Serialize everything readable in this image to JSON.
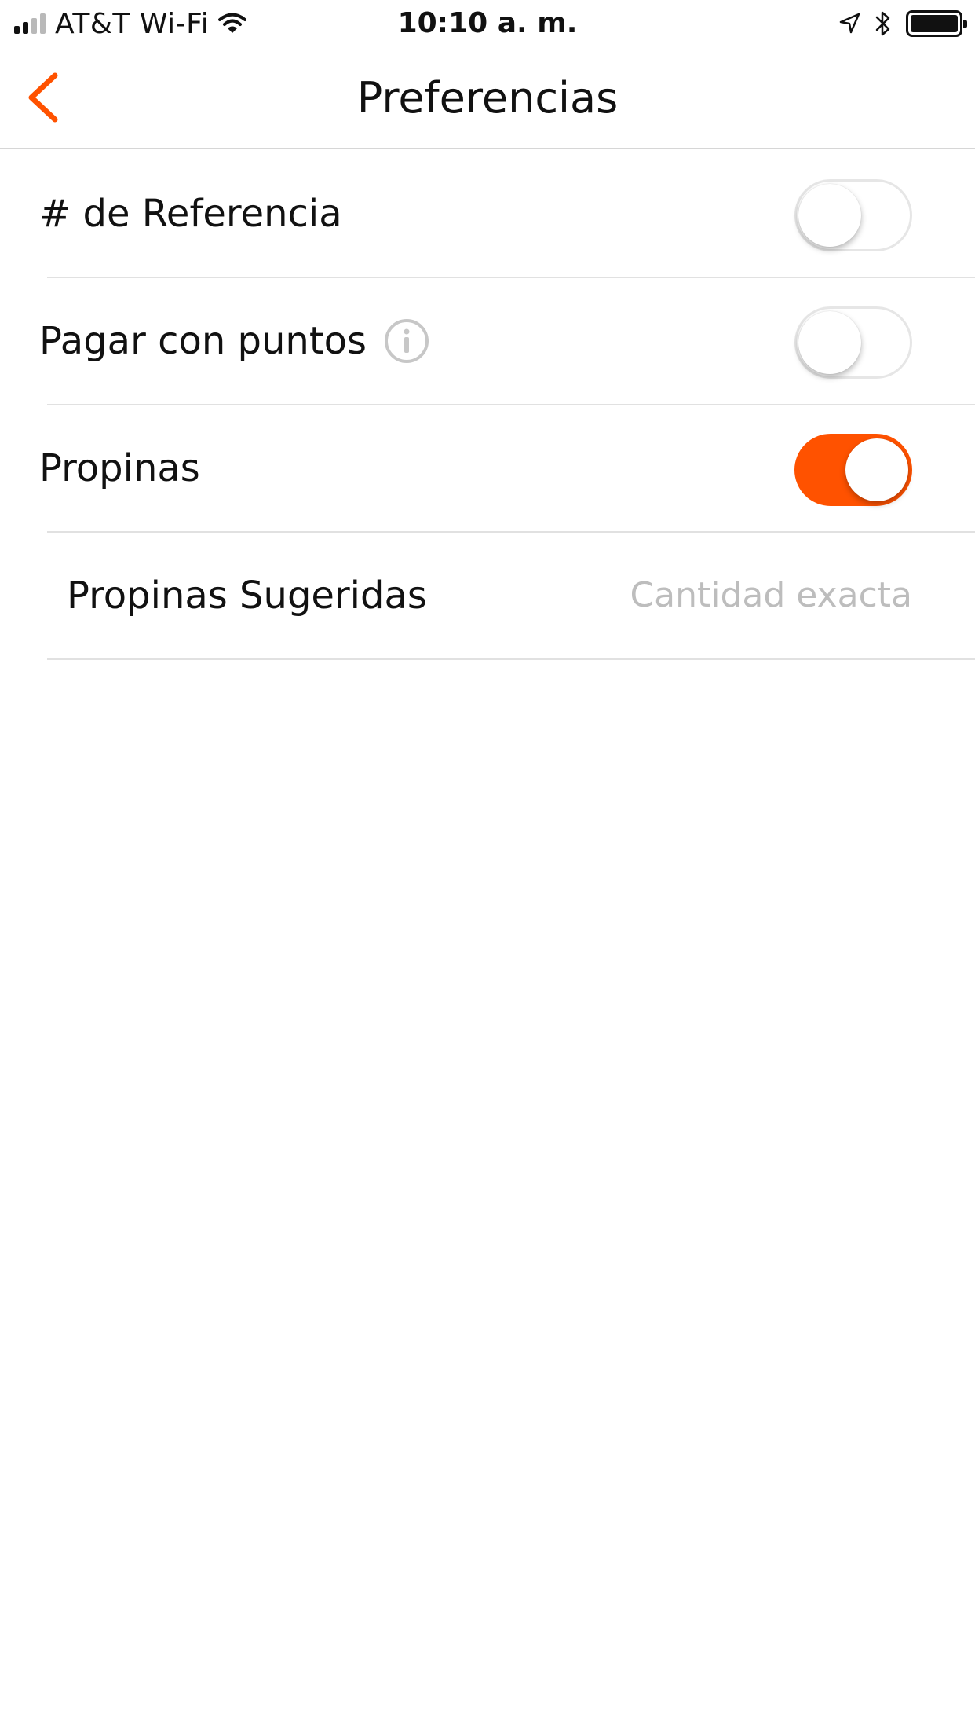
{
  "status_bar": {
    "carrier": "AT&T Wi-Fi",
    "time": "10:10 a. m.",
    "icons": [
      "signal-bars-icon",
      "wifi-icon",
      "location-arrow-icon",
      "bluetooth-icon",
      "battery-icon"
    ]
  },
  "nav": {
    "title": "Preferencias",
    "back_icon": "chevron-left-icon",
    "accent_color": "#ff5200"
  },
  "settings": {
    "reference": {
      "label": "# de Referencia",
      "enabled": false
    },
    "points": {
      "label": "Pagar con puntos",
      "info_icon": "info-circle-icon",
      "enabled": false
    },
    "tips": {
      "label": "Propinas",
      "enabled": true
    },
    "suggested_tips": {
      "label": "Propinas Sugeridas",
      "value": "Cantidad exacta"
    }
  },
  "colors": {
    "accent": "#ff5200",
    "separator": "#e1e1e1",
    "value_text": "#bdbdbd"
  }
}
